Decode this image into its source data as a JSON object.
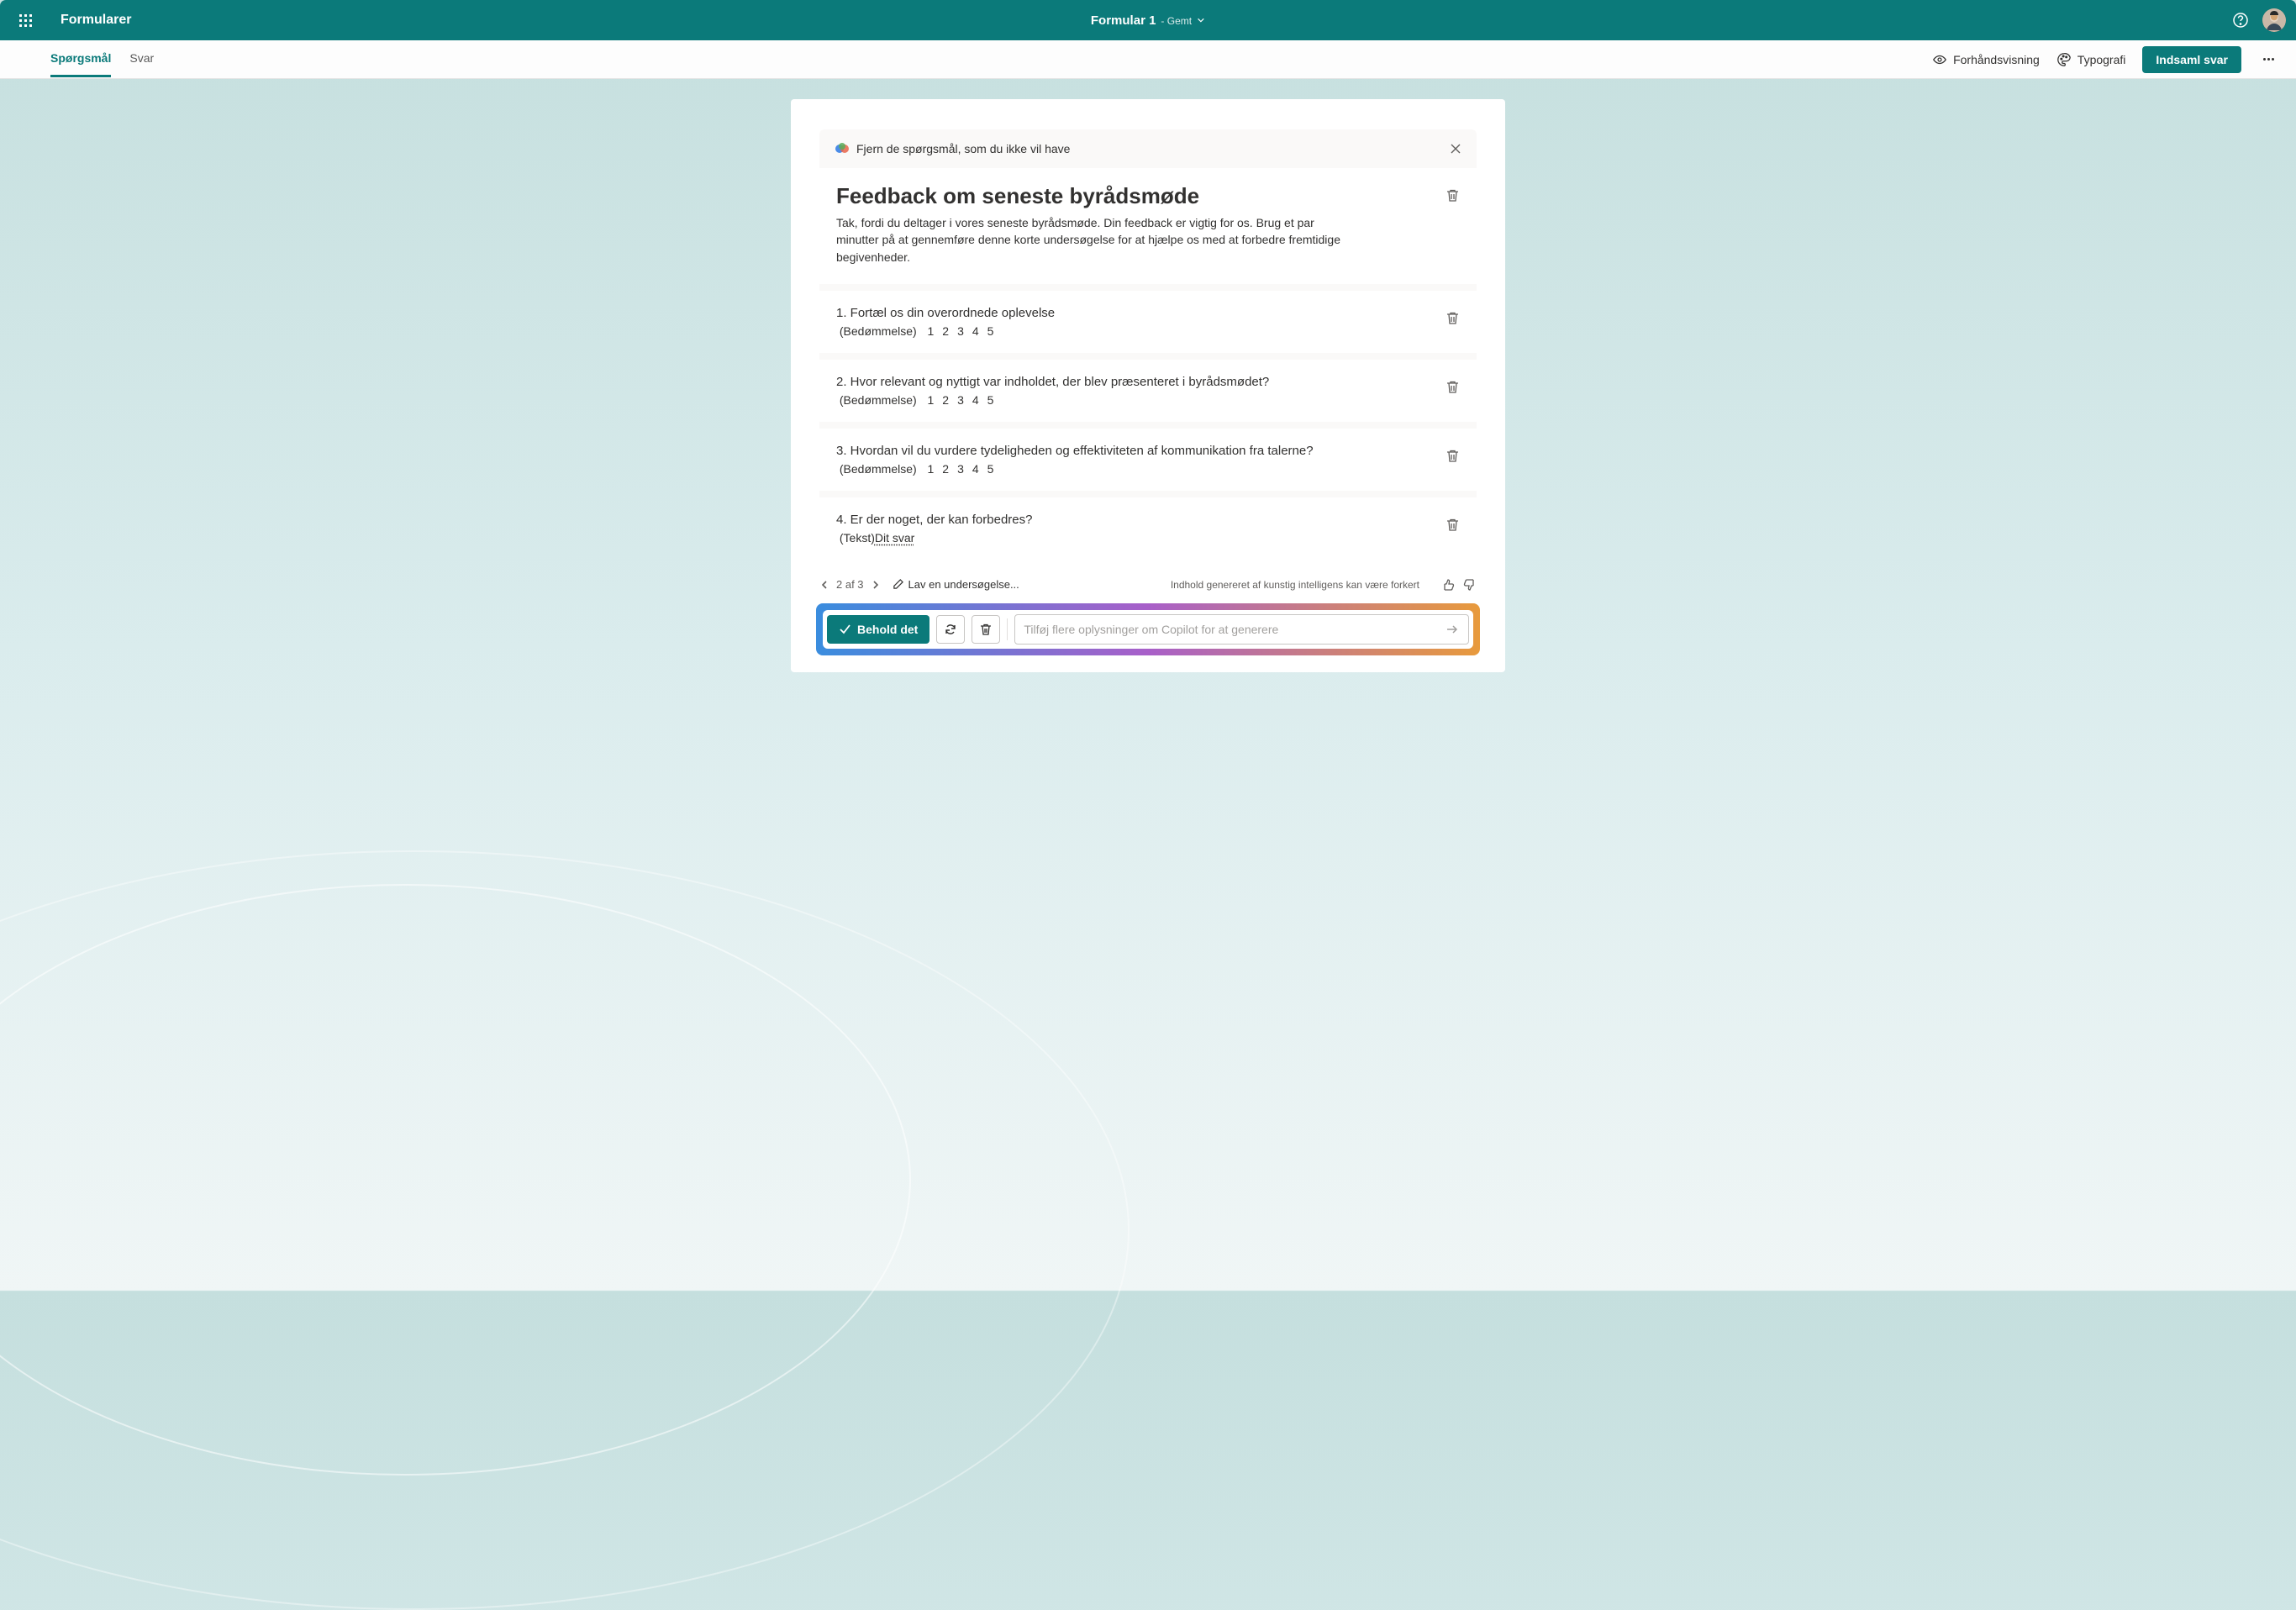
{
  "topbar": {
    "app_name": "Formularer",
    "form_name": "Formular 1",
    "saved_suffix": "- Gemt"
  },
  "toolbar": {
    "tabs": {
      "questions": "Spørgsmål",
      "answers": "Svar"
    },
    "preview": "Forhåndsvisning",
    "typography": "Typografi",
    "collect": "Indsaml svar"
  },
  "copilot": {
    "banner": "Fjern de spørgsmål, som du ikke vil have"
  },
  "form": {
    "title": "Feedback om seneste byrådsmøde",
    "description": "Tak, fordi du deltager i vores seneste byrådsmøde. Din feedback er vigtig for os. Brug et par minutter på at gennemføre denne korte undersøgelse for at hjælpe os med at forbedre fremtidige begivenheder."
  },
  "rating_label": "(Bedømmelse)",
  "rating_values": "1   2   3   4   5",
  "text_label": "(Tekst)",
  "answer_placeholder": "Dit svar",
  "questions": [
    {
      "num": "1.",
      "text": "Fortæl os din overordnede oplevelse",
      "type": "rating"
    },
    {
      "num": "2.",
      "text": "Hvor relevant og nyttigt var indholdet, der blev præsenteret i byrådsmødet?",
      "type": "rating"
    },
    {
      "num": "3.",
      "text": "Hvordan vil du vurdere tydeligheden og effektiviteten af kommunikation fra talerne?",
      "type": "rating"
    },
    {
      "num": "4.",
      "text": "Er der noget, der kan forbedres?",
      "type": "text"
    }
  ],
  "pager": {
    "text": "2 af 3",
    "edit": "Lav en undersøgelse..."
  },
  "disclaimer": "Indhold genereret af kunstig intelligens kan være forkert",
  "actions": {
    "keep": "Behold det",
    "input_placeholder": "Tilføj flere oplysninger om Copilot for at generere"
  }
}
